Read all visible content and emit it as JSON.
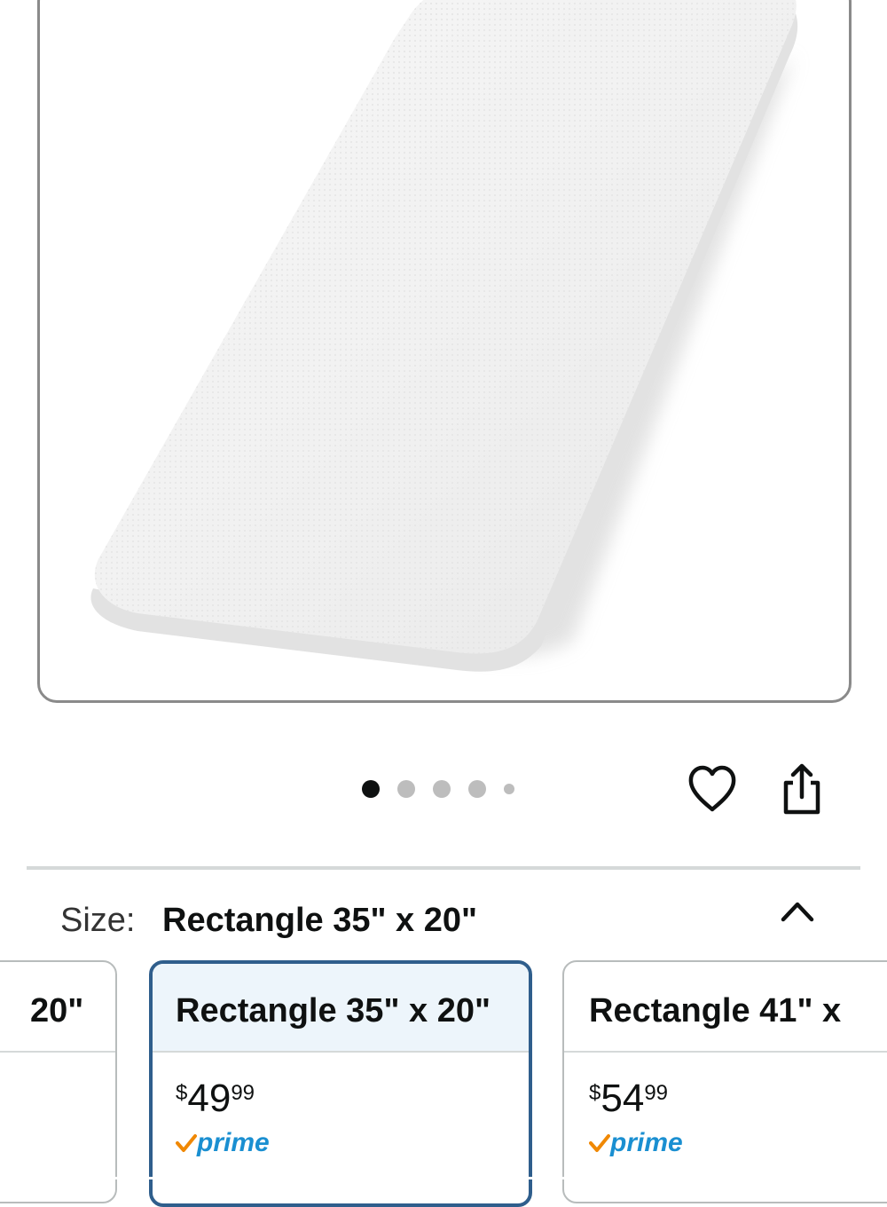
{
  "carousel": {
    "image_alt": "White rectangular memory foam pillow",
    "dot_count": 5,
    "active_index": 0
  },
  "actions": {
    "favorite_icon": "heart-icon",
    "share_icon": "share-icon"
  },
  "size_selector": {
    "label": "Size:",
    "selected_value": "Rectangle 35\" x 20\"",
    "collapse_icon": "chevron-up-icon",
    "options": [
      {
        "title": "20\"",
        "price_currency": "",
        "price_whole": "",
        "price_fraction": "",
        "prime": false
      },
      {
        "title": "Rectangle 35\" x 20\"",
        "price_currency": "$",
        "price_whole": "49",
        "price_fraction": "99",
        "prime": true,
        "selected": true
      },
      {
        "title": "Rectangle 41\" x",
        "price_currency": "$",
        "price_whole": "54",
        "price_fraction": "99",
        "prime": true
      }
    ]
  },
  "prime_badge": {
    "text": "prime",
    "check_color": "#f08804",
    "text_color": "#1a8fd1"
  },
  "colors": {
    "selected_border": "#2f5e8c",
    "selected_header_bg": "#edf5fb"
  }
}
